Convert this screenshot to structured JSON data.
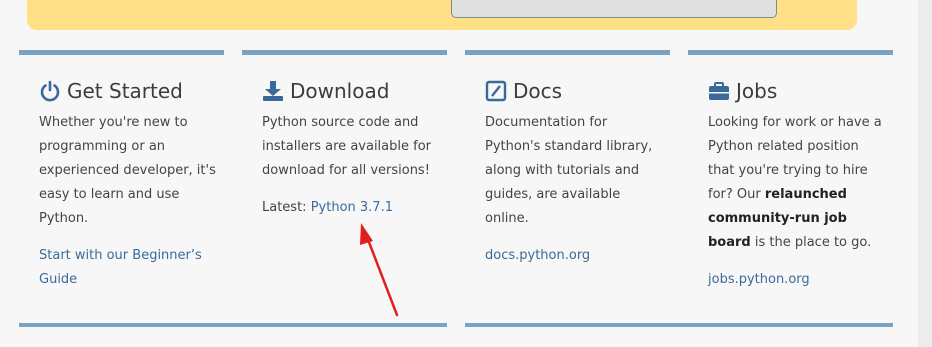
{
  "columns": {
    "get_started": {
      "title": "Get Started",
      "icon": "power-icon",
      "body": "Whether you're new to programming or an experienced developer, it's easy to learn and use Python.",
      "link": "Start with our Beginner’s Guide"
    },
    "download": {
      "title": "Download",
      "icon": "download-icon",
      "body": "Python source code and installers are available for download for all versions!",
      "latest_label": "Latest:",
      "latest_link": "Python 3.7.1"
    },
    "docs": {
      "title": "Docs",
      "icon": "docs-icon",
      "body": "Documentation for Python's standard library, along with tutorials and guides, are available online.",
      "link": "docs.python.org"
    },
    "jobs": {
      "title": "Jobs",
      "icon": "briefcase-icon",
      "body_start": "Looking for work or have a Python related position that you're trying to hire for? Our ",
      "body_bold": "relaunched community-run job board",
      "body_end": " is the place to go.",
      "link": "jobs.python.org"
    }
  },
  "colors": {
    "accent_bar": "#7ba3c1",
    "link": "#3b6a9a",
    "banner": "#ffe087",
    "annotation_arrow": "#e02020"
  }
}
